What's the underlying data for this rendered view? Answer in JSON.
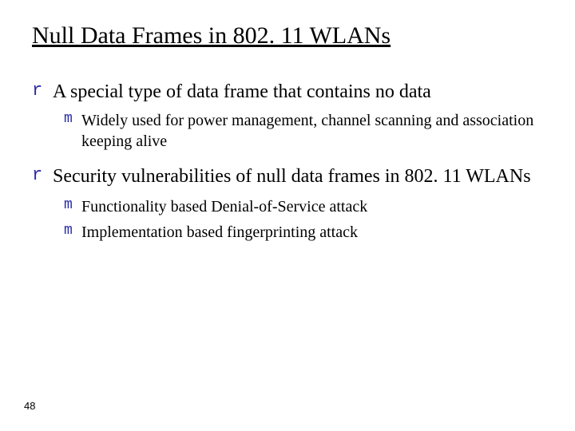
{
  "title": "Null Data Frames in 802. 11 WLANs",
  "items": [
    {
      "marker": "r",
      "text": "A special type of data frame that contains no data",
      "children": [
        {
          "marker": "m",
          "text": "Widely used for power management, channel scanning and association keeping alive"
        }
      ]
    },
    {
      "marker": "r",
      "text": "Security vulnerabilities of null data frames in 802. 11 WLANs",
      "children": [
        {
          "marker": "m",
          "text": "Functionality based Denial-of-Service attack"
        },
        {
          "marker": "m",
          "text": "Implementation based fingerprinting attack"
        }
      ]
    }
  ],
  "page_number": "48"
}
